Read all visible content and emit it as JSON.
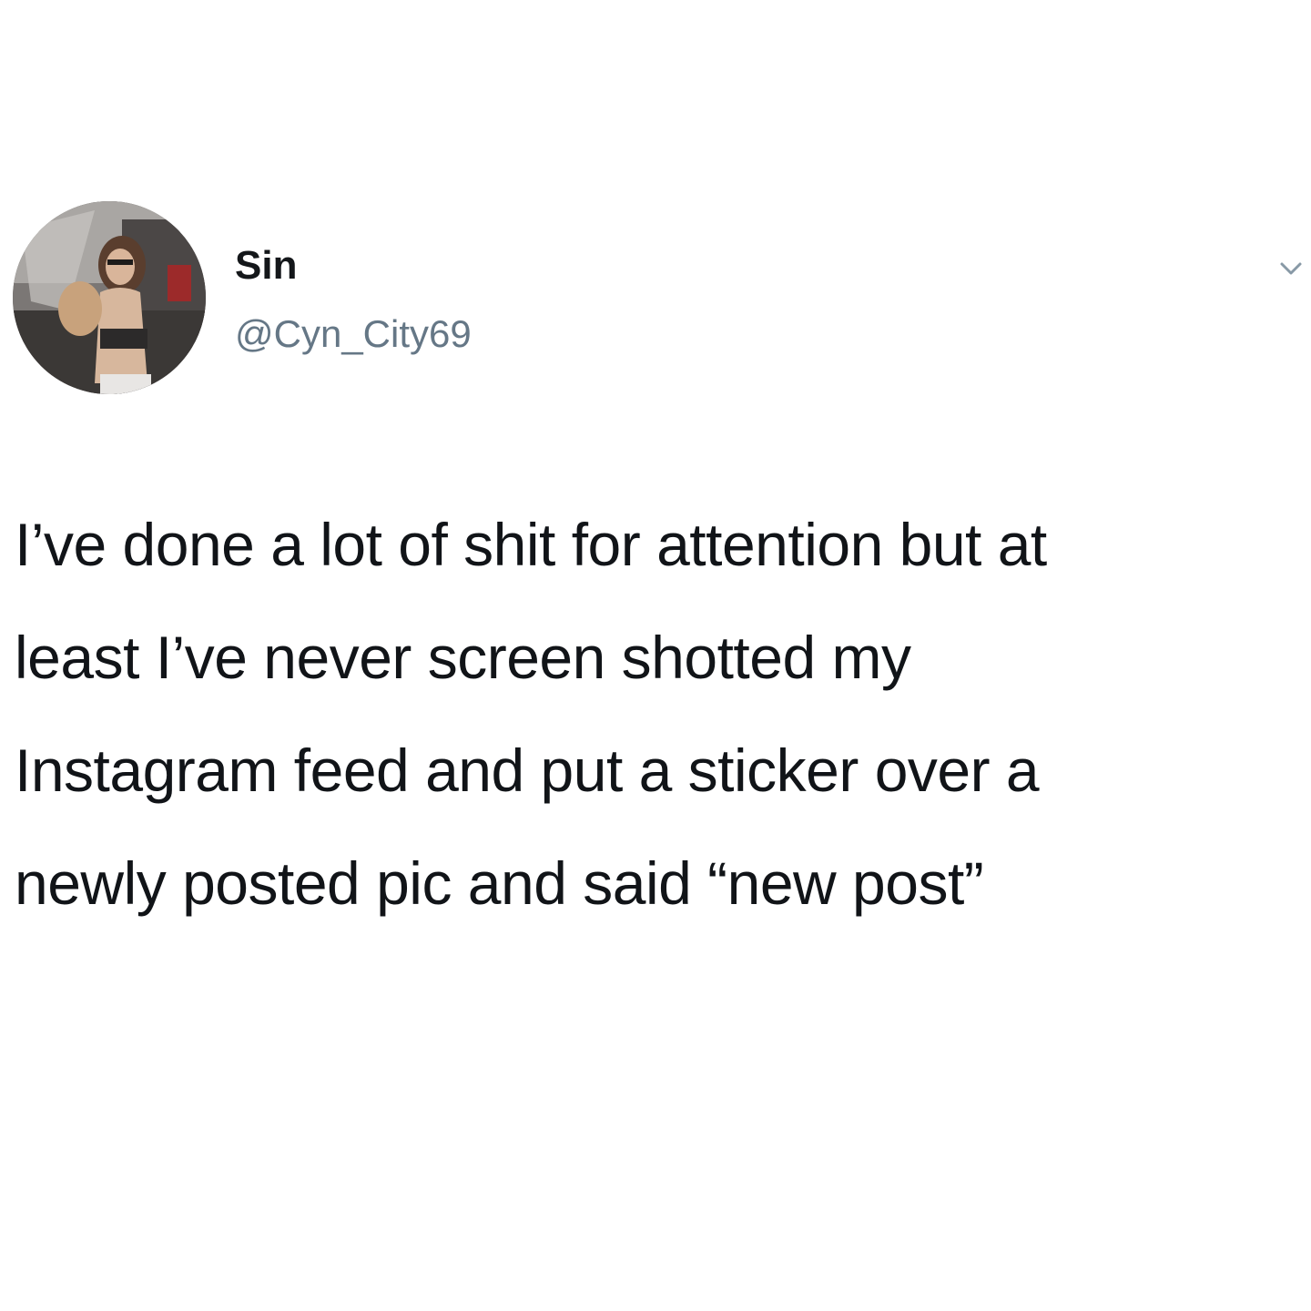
{
  "tweet": {
    "author": {
      "display_name": "Sin",
      "handle": "@Cyn_City69",
      "avatar_icon": "profile-photo"
    },
    "menu_icon": "chevron-down-icon",
    "text_lines": [
      "I’ve done a lot of shit for attention but at",
      "least I’ve never screen shotted my",
      "Instagram feed and put a sticker over a",
      "newly posted pic and said “new post”"
    ]
  },
  "colors": {
    "background": "#ffffff",
    "text": "#111418",
    "handle": "#657786",
    "caret": "#8899a6"
  }
}
